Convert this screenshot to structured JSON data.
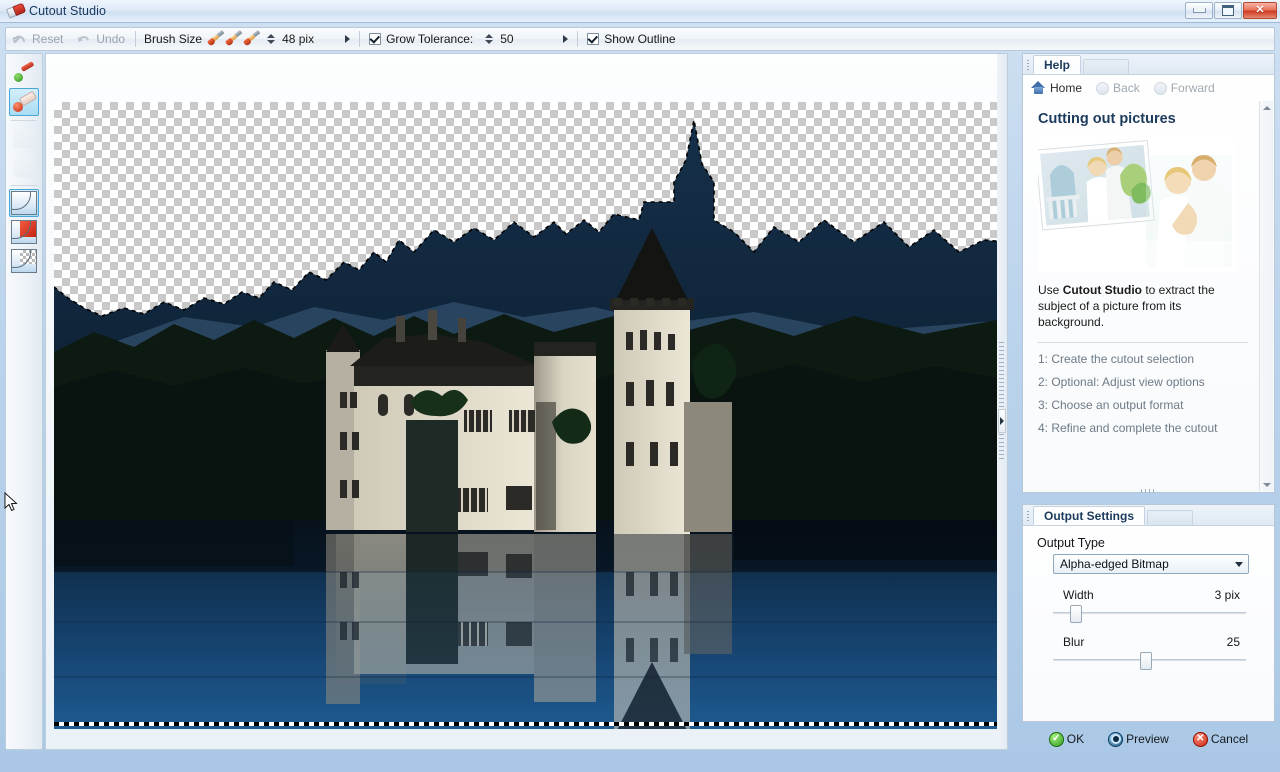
{
  "window": {
    "title": "Cutout Studio",
    "icon": "eraser-icon",
    "controls": {
      "minimize": "–",
      "maximize": "□",
      "close": "✕"
    }
  },
  "toolbar": {
    "reset_label": "Reset",
    "undo_label": "Undo",
    "brush_size_label": "Brush Size",
    "brush_size_value": "48 pix",
    "brush_icons": [
      "brush-small-icon",
      "brush-medium-icon",
      "brush-large-icon"
    ],
    "more_arrow": "▶",
    "grow_tolerance_label": "Grow Tolerance:",
    "grow_tolerance_checked": true,
    "grow_tolerance_value": "50",
    "show_outline_label": "Show Outline",
    "show_outline_checked": true
  },
  "tools": [
    {
      "name": "add-to-selection-brush",
      "selected": false
    },
    {
      "name": "remove-from-selection-brush",
      "selected": true
    },
    {
      "name": "disabled-tool-1",
      "selected": false
    },
    {
      "name": "disabled-tool-2",
      "selected": false
    },
    {
      "name": "view-original-image",
      "selected": true
    },
    {
      "name": "view-red-overlay",
      "selected": false
    },
    {
      "name": "view-transparent-checker",
      "selected": false
    }
  ],
  "help": {
    "tab_label": "Help",
    "nav": {
      "home": "Home",
      "back": "Back",
      "forward": "Forward"
    },
    "heading": "Cutting out pictures",
    "image_alt": "couple-photo-illustration",
    "intro_pre": "Use ",
    "intro_bold": "Cutout Studio",
    "intro_post": " to extract the subject of a picture from its background.",
    "steps": [
      "1: Create the cutout selection",
      "2: Optional: Adjust view options",
      "3: Choose an output format",
      "4: Refine and complete the cutout"
    ]
  },
  "output_settings": {
    "tab_label": "Output Settings",
    "output_type_label": "Output Type",
    "output_type_value": "Alpha-edged Bitmap",
    "output_type_options": [
      "Alpha-edged Bitmap"
    ],
    "width_label": "Width",
    "width_value": "3 pix",
    "width_percent": 12,
    "blur_label": "Blur",
    "blur_value": "25",
    "blur_percent": 48
  },
  "buttons": {
    "ok": "OK",
    "preview": "Preview",
    "cancel": "Cancel"
  },
  "canvas": {
    "image_subject": "castle-reflected-in-lake",
    "selection_outline": true,
    "transparency_checker": true
  },
  "colors": {
    "accent": "#49a7d8",
    "title_text": "#17375e",
    "close_button": "#cf3a22",
    "ok_green": "#2d9420",
    "cancel_red": "#c41f0c",
    "panel_border": "#b7c8d8"
  }
}
